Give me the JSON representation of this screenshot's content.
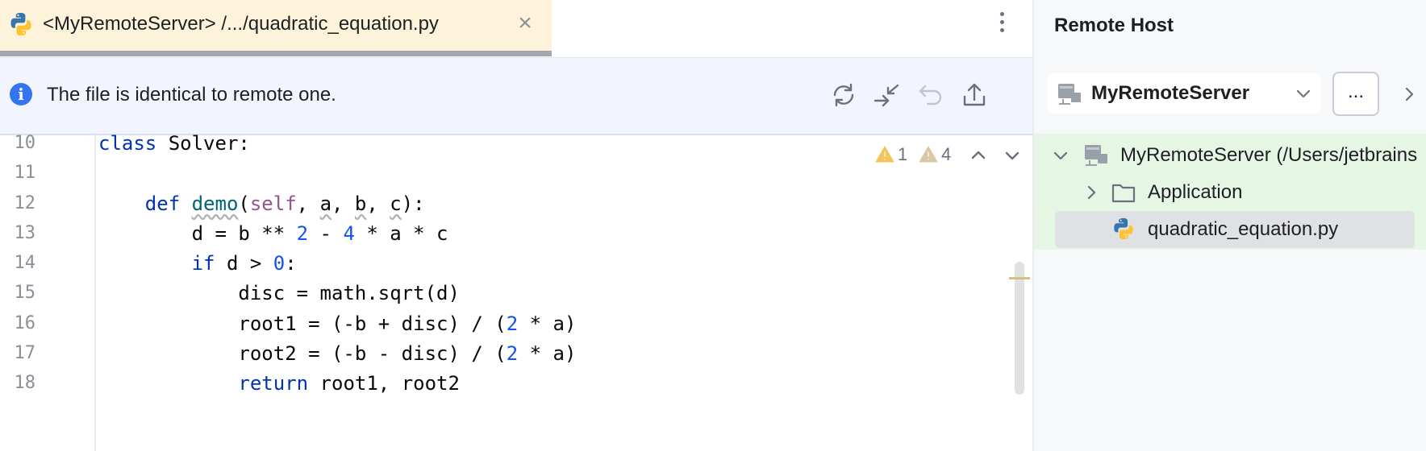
{
  "tab": {
    "title": "<MyRemoteServer> /.../quadratic_equation.py",
    "close": "×"
  },
  "notification": {
    "text": "The file is identical to remote one.",
    "info_glyph": "i"
  },
  "inspections": {
    "warnings": "1",
    "weak_warnings": "4"
  },
  "editor": {
    "line_numbers": [
      "10",
      "11",
      "12",
      "13",
      "14",
      "15",
      "16",
      "17",
      "18"
    ],
    "lines": [
      [
        {
          "t": "class",
          "c": "kw"
        },
        {
          "t": " Solver:",
          "c": ""
        }
      ],
      [],
      [
        {
          "t": "    ",
          "c": ""
        },
        {
          "t": "def",
          "c": "kw"
        },
        {
          "t": " ",
          "c": ""
        },
        {
          "t": "demo",
          "c": "fn"
        },
        {
          "t": "(",
          "c": ""
        },
        {
          "t": "self",
          "c": "self"
        },
        {
          "t": ", ",
          "c": ""
        },
        {
          "t": "a",
          "c": "wavy"
        },
        {
          "t": ", ",
          "c": ""
        },
        {
          "t": "b",
          "c": "wavy"
        },
        {
          "t": ", ",
          "c": ""
        },
        {
          "t": "c",
          "c": "wavy"
        },
        {
          "t": "):",
          "c": ""
        }
      ],
      [
        {
          "t": "        d = b ** ",
          "c": ""
        },
        {
          "t": "2",
          "c": "num"
        },
        {
          "t": " - ",
          "c": ""
        },
        {
          "t": "4",
          "c": "num"
        },
        {
          "t": " * a * c",
          "c": ""
        }
      ],
      [
        {
          "t": "        ",
          "c": ""
        },
        {
          "t": "if",
          "c": "kw"
        },
        {
          "t": " d > ",
          "c": ""
        },
        {
          "t": "0",
          "c": "num"
        },
        {
          "t": ":",
          "c": ""
        }
      ],
      [
        {
          "t": "            disc = math.sqrt(d)",
          "c": ""
        }
      ],
      [
        {
          "t": "            root1 = (-b + disc) / (",
          "c": ""
        },
        {
          "t": "2",
          "c": "num"
        },
        {
          "t": " * a)",
          "c": ""
        }
      ],
      [
        {
          "t": "            root2 = (-b - disc) / (",
          "c": ""
        },
        {
          "t": "2",
          "c": "num"
        },
        {
          "t": " * a)",
          "c": ""
        }
      ],
      [
        {
          "t": "            ",
          "c": ""
        },
        {
          "t": "return",
          "c": "kw"
        },
        {
          "t": " root1, root2",
          "c": ""
        }
      ]
    ]
  },
  "panel": {
    "title": "Remote Host",
    "server_select": "MyRemoteServer",
    "more_button": "...",
    "tree": [
      {
        "label": "MyRemoteServer (/Users/jetbrains",
        "icon": "server-icon",
        "expanded": true,
        "level": 0
      },
      {
        "label": "Application",
        "icon": "folder-icon",
        "expanded": false,
        "level": 1
      },
      {
        "label": "quadratic_equation.py",
        "icon": "python-file-icon",
        "level": 1,
        "selected": true
      }
    ]
  },
  "colors": {
    "tab_bg": "#fdf3db",
    "notification_bg": "#f2f5fd",
    "tree_changed_bg": "#e5f6e5",
    "keyword": "#0033b3",
    "number": "#1750eb",
    "info_blue": "#3574f0",
    "warning_yellow": "#f2c55c"
  }
}
